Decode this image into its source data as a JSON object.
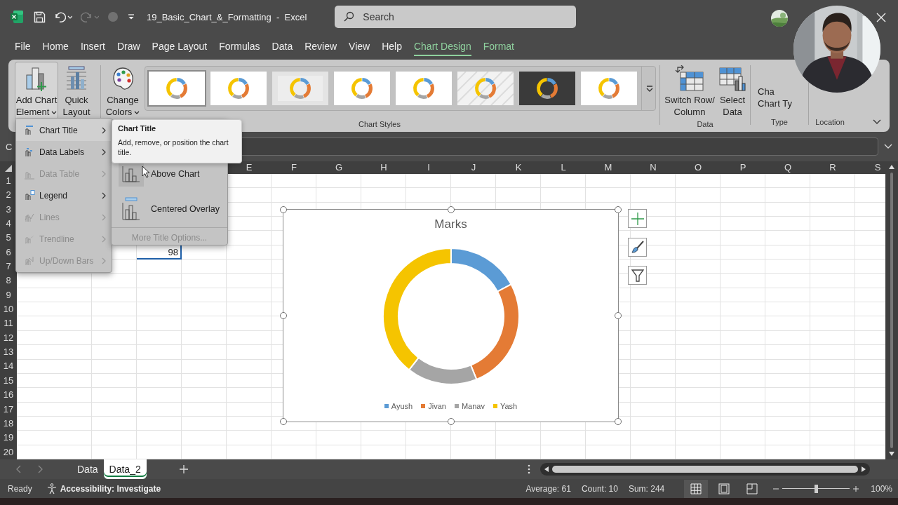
{
  "title_bar": {
    "title": "19_Basic_Chart_&_Formatting  -  Excel",
    "search": {
      "placeholder": "Search"
    },
    "quick_access": [
      {
        "kind": "save",
        "disabled": false
      },
      {
        "kind": "undo",
        "disabled": false
      },
      {
        "kind": "redo",
        "disabled": true
      },
      {
        "kind": "autosave",
        "disabled": true
      },
      {
        "kind": "customize",
        "disabled": false
      }
    ]
  },
  "ribbon_tabs": [
    {
      "label": "File",
      "selected": false,
      "contextual": false
    },
    {
      "label": "Home",
      "selected": false,
      "contextual": false
    },
    {
      "label": "Insert",
      "selected": false,
      "contextual": false
    },
    {
      "label": "Draw",
      "selected": false,
      "contextual": false
    },
    {
      "label": "Page Layout",
      "selected": false,
      "contextual": false
    },
    {
      "label": "Formulas",
      "selected": false,
      "contextual": false
    },
    {
      "label": "Data",
      "selected": false,
      "contextual": false
    },
    {
      "label": "Review",
      "selected": false,
      "contextual": false
    },
    {
      "label": "View",
      "selected": false,
      "contextual": false
    },
    {
      "label": "Help",
      "selected": false,
      "contextual": false
    },
    {
      "label": "Chart Design",
      "selected": true,
      "contextual": true
    },
    {
      "label": "Format",
      "selected": false,
      "contextual": true
    }
  ],
  "ribbon": {
    "layout_buttons": [
      {
        "label": "Add Chart\nElement",
        "kind": "add-element",
        "pressed": true
      },
      {
        "label": "Quick\nLayout",
        "kind": "quick-layout",
        "pressed": false
      }
    ],
    "chart_styles": {
      "label": "Chart Styles",
      "change_colors": "Change\nColors",
      "thumbnails": [
        {
          "kind": "plain",
          "selected": true
        },
        {
          "kind": "plain",
          "selected": false
        },
        {
          "kind": "gradient",
          "selected": false
        },
        {
          "kind": "plain",
          "selected": false
        },
        {
          "kind": "plain",
          "selected": false
        },
        {
          "kind": "striped",
          "selected": false
        },
        {
          "kind": "dark",
          "selected": false
        },
        {
          "kind": "plain",
          "selected": false
        }
      ]
    },
    "data_group": {
      "label": "Data",
      "buttons": [
        {
          "label": "Switch Row/\nColumn",
          "kind": "switch"
        },
        {
          "label": "Select\nData",
          "kind": "select"
        }
      ]
    },
    "type_group": {
      "label": "Type",
      "button": "Cha\nChart Ty"
    },
    "location_group": {
      "label": "Location"
    }
  },
  "formula_bar": {
    "name_box": "C"
  },
  "columns": [
    "E",
    "F",
    "G",
    "H",
    "I",
    "J",
    "K",
    "L",
    "M",
    "N",
    "O",
    "P",
    "Q",
    "R",
    "S"
  ],
  "rows": [
    "1",
    "2",
    "3",
    "4",
    "5",
    "6",
    "7",
    "8",
    "9",
    "10",
    "11",
    "12",
    "13",
    "14",
    "15",
    "16",
    "17",
    "18",
    "19",
    "20"
  ],
  "active_cell": {
    "value": "98"
  },
  "chart": {
    "title": "Marks",
    "legend": [
      {
        "name": "Ayush",
        "color": "#5b9bd5"
      },
      {
        "name": "Jivan",
        "color": "#e47b35"
      },
      {
        "name": "Manav",
        "color": "#a5a5a5"
      },
      {
        "name": "Yash",
        "color": "#f5c400"
      }
    ]
  },
  "chart_tools": [
    {
      "kind": "elements"
    },
    {
      "kind": "styles"
    },
    {
      "kind": "filters"
    }
  ],
  "add_chart_element_menu": [
    {
      "label": "Chart Title",
      "kind": "title",
      "disabled": false,
      "selected": true
    },
    {
      "label": "Data Labels",
      "kind": "labels",
      "disabled": false,
      "selected": false
    },
    {
      "label": "Data Table",
      "kind": "table",
      "disabled": true,
      "selected": false
    },
    {
      "label": "Legend",
      "kind": "legend",
      "disabled": false,
      "selected": false
    },
    {
      "label": "Lines",
      "kind": "lines",
      "disabled": true,
      "selected": false
    },
    {
      "label": "Trendline",
      "kind": "trendline",
      "disabled": true,
      "selected": false
    },
    {
      "label": "Up/Down Bars",
      "kind": "updown",
      "disabled": true,
      "selected": false
    }
  ],
  "chart_title_submenu": {
    "items": [
      {
        "label": "Above Chart",
        "kind": "above",
        "selected": true
      },
      {
        "label": "Centered Overlay",
        "kind": "overlay",
        "selected": false
      }
    ],
    "more": {
      "label": "More Title Options...",
      "disabled": true
    }
  },
  "tooltip": {
    "title": "Chart Title",
    "text": "Add, remove, or position the chart title."
  },
  "sheet_tabs": [
    {
      "label": "Data",
      "selected": false
    },
    {
      "label": "Data_2",
      "selected": true
    }
  ],
  "status_bar": {
    "mode": "Ready",
    "accessibility": "Accessibility: Investigate",
    "stats": [
      "Average: 61",
      "Count: 10",
      "Sum: 244"
    ],
    "views": [
      {
        "kind": "normal",
        "selected": true
      },
      {
        "kind": "page-layout",
        "selected": false
      },
      {
        "kind": "page-break",
        "selected": false
      }
    ],
    "zoom": {
      "level": 0.5,
      "reading": "100%"
    }
  }
}
